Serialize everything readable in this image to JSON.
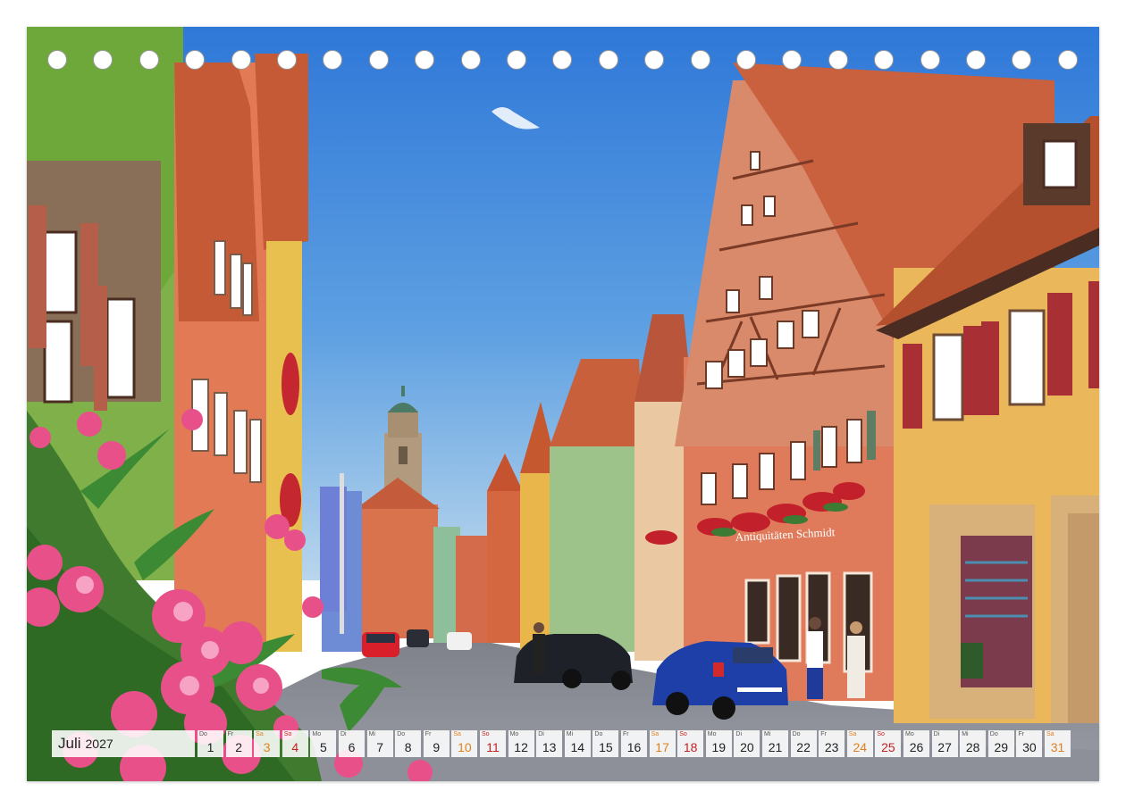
{
  "calendar": {
    "month": "Juli",
    "year": "2027",
    "days": [
      {
        "wd": "Do",
        "n": "1",
        "type": "wk"
      },
      {
        "wd": "Fr",
        "n": "2",
        "type": "wk"
      },
      {
        "wd": "Sa",
        "n": "3",
        "type": "sa"
      },
      {
        "wd": "So",
        "n": "4",
        "type": "so"
      },
      {
        "wd": "Mo",
        "n": "5",
        "type": "wk"
      },
      {
        "wd": "Di",
        "n": "6",
        "type": "wk"
      },
      {
        "wd": "Mi",
        "n": "7",
        "type": "wk"
      },
      {
        "wd": "Do",
        "n": "8",
        "type": "wk"
      },
      {
        "wd": "Fr",
        "n": "9",
        "type": "wk"
      },
      {
        "wd": "Sa",
        "n": "10",
        "type": "sa"
      },
      {
        "wd": "So",
        "n": "11",
        "type": "so"
      },
      {
        "wd": "Mo",
        "n": "12",
        "type": "wk"
      },
      {
        "wd": "Di",
        "n": "13",
        "type": "wk"
      },
      {
        "wd": "Mi",
        "n": "14",
        "type": "wk"
      },
      {
        "wd": "Do",
        "n": "15",
        "type": "wk"
      },
      {
        "wd": "Fr",
        "n": "16",
        "type": "wk"
      },
      {
        "wd": "Sa",
        "n": "17",
        "type": "sa"
      },
      {
        "wd": "So",
        "n": "18",
        "type": "so"
      },
      {
        "wd": "Mo",
        "n": "19",
        "type": "wk"
      },
      {
        "wd": "Di",
        "n": "20",
        "type": "wk"
      },
      {
        "wd": "Mi",
        "n": "21",
        "type": "wk"
      },
      {
        "wd": "Do",
        "n": "22",
        "type": "wk"
      },
      {
        "wd": "Fr",
        "n": "23",
        "type": "wk"
      },
      {
        "wd": "Sa",
        "n": "24",
        "type": "sa"
      },
      {
        "wd": "So",
        "n": "25",
        "type": "so"
      },
      {
        "wd": "Mo",
        "n": "26",
        "type": "wk"
      },
      {
        "wd": "Di",
        "n": "27",
        "type": "wk"
      },
      {
        "wd": "Mi",
        "n": "28",
        "type": "wk"
      },
      {
        "wd": "Do",
        "n": "29",
        "type": "wk"
      },
      {
        "wd": "Fr",
        "n": "30",
        "type": "wk"
      },
      {
        "wd": "Sa",
        "n": "31",
        "type": "sa"
      }
    ]
  },
  "photo": {
    "shop_sign": "Antiquitäten Schmidt",
    "colors": {
      "sky_top": "#2f78d8",
      "sky_bottom": "#a9cdea",
      "roof": "#c9623f",
      "green_house": "#7aaa3a",
      "salmon_house": "#e27e5c",
      "yellow_house": "#efbf55",
      "cobble": "#8a8d96",
      "car_blue": "#1e3fa8",
      "flowers": "#e8508a"
    }
  }
}
